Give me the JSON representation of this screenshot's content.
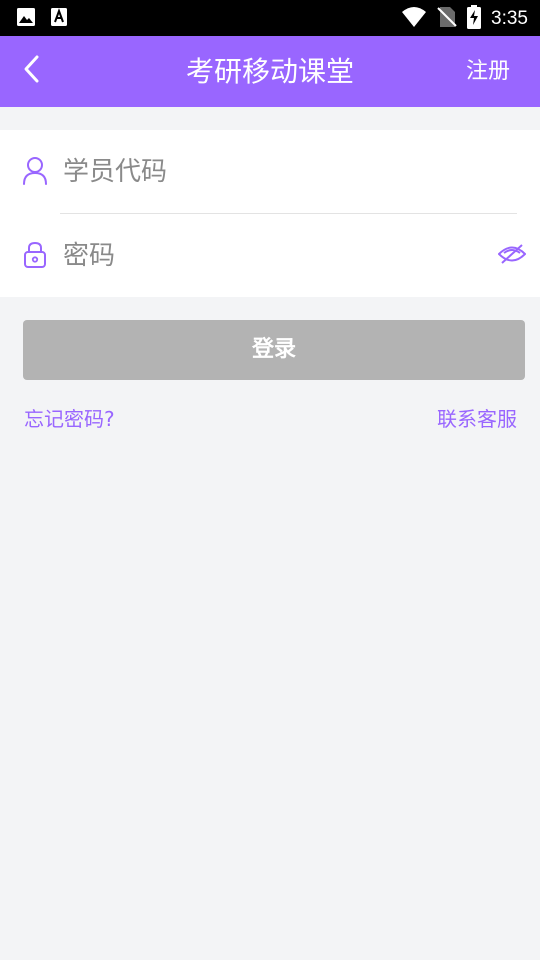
{
  "status_bar": {
    "time": "3:35",
    "icons": [
      "image-icon",
      "font-icon",
      "wifi-icon",
      "no-sim-icon",
      "battery-charging-icon"
    ]
  },
  "header": {
    "title": "考研移动课堂",
    "back_icon": "chevron-left-icon",
    "register_label": "注册"
  },
  "form": {
    "student_code_placeholder": "学员代码",
    "password_placeholder": "密码",
    "user_icon": "user-icon",
    "lock_icon": "lock-icon",
    "eye_icon": "eye-hidden-icon"
  },
  "actions": {
    "login_label": "登录",
    "forgot_password_label": "忘记密码?",
    "contact_service_label": "联系客服"
  },
  "colors": {
    "accent": "#9966ff",
    "login_disabled": "#b3b3b3",
    "background": "#f3f4f6"
  }
}
